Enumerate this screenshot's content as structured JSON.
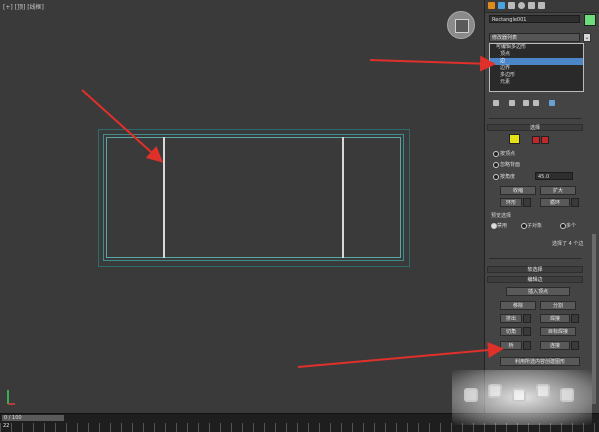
{
  "viewport": {
    "label": "[+] [顶] [线框]"
  },
  "panel": {
    "object_name": "Rectangle001",
    "modifier_list": "修改器列表",
    "stack_items": [
      {
        "label": "可编辑多边形"
      },
      {
        "label": "顶点"
      },
      {
        "label": "边",
        "selected": true
      },
      {
        "label": "边界"
      },
      {
        "label": "多边形"
      },
      {
        "label": "元素"
      }
    ],
    "selection": {
      "title": "选择",
      "by_vertex": "按顶点",
      "ignore_backfacing": "忽略背面",
      "by_angle": "按角度",
      "angle_value": "45.0",
      "shrink": "收缩",
      "grow": "扩大",
      "ring": "环形",
      "loop": "循环",
      "preview_title": "预览选择",
      "disable": "禁用",
      "sub_object": "子对象",
      "multi": "多个",
      "status": "选择了 4 个边"
    },
    "soft_selection": {
      "title": "软选择"
    },
    "edit_edges": {
      "title": "编辑边",
      "insert_vertex": "插入顶点",
      "remove": "移除",
      "split": "分割",
      "extrude": "挤出",
      "weld": "焊接",
      "chamfer": "切角",
      "target_weld": "目标焊接",
      "bridge": "桥",
      "connect": "连接",
      "create_shape": "利用所选内容创建图形"
    }
  },
  "timebar": {
    "slider_label": "0 / 100",
    "frame": "22"
  },
  "colors": {
    "object": "#6ddc7a",
    "selected": "#4a86c8",
    "arrow": "#e0302a"
  }
}
